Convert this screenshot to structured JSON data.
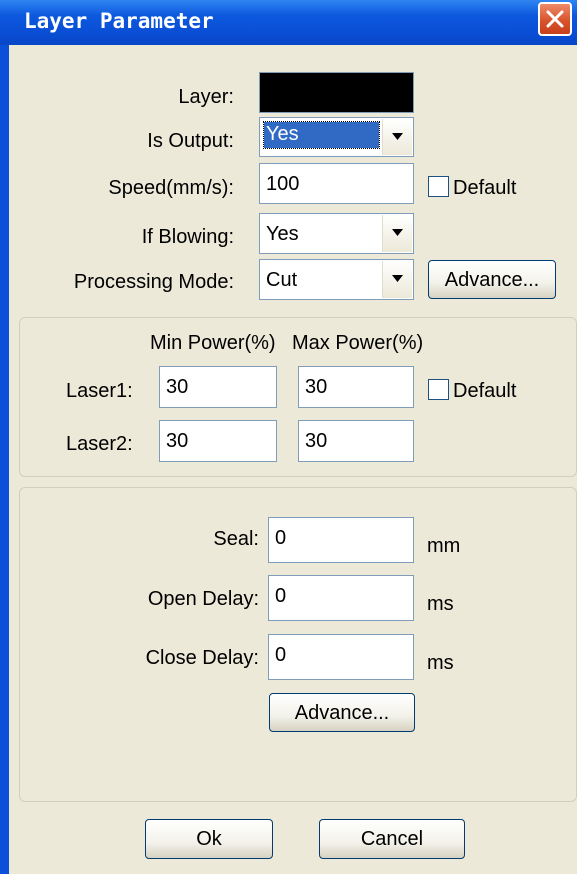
{
  "window": {
    "title": "Layer Parameter",
    "close_icon": "close-icon"
  },
  "colors": {
    "title_bar": "#0a50d8",
    "client_bg": "#ece9d8",
    "close_button": "#d8542d",
    "selection": "#316ac5",
    "layer_color": "#000000"
  },
  "general": {
    "layer_label": "Layer:",
    "is_output_label": "Is Output:",
    "is_output_value": "Yes",
    "speed_label": "Speed(mm/s):",
    "speed_value": "100",
    "speed_default_label": "Default",
    "blowing_label": "If Blowing:",
    "blowing_value": "Yes",
    "mode_label": "Processing Mode:",
    "mode_value": "Cut",
    "advance_label": "Advance..."
  },
  "power": {
    "min_header": "Min Power(%)",
    "max_header": "Max Power(%)",
    "laser1_label": "Laser1:",
    "laser1_min": "30",
    "laser1_max": "30",
    "default_label": "Default",
    "laser2_label": "Laser2:",
    "laser2_min": "30",
    "laser2_max": "30"
  },
  "timing": {
    "seal_label": "Seal:",
    "seal_value": "0",
    "seal_unit": "mm",
    "open_delay_label": "Open Delay:",
    "open_delay_value": "0",
    "open_delay_unit": "ms",
    "close_delay_label": "Close Delay:",
    "close_delay_value": "0",
    "close_delay_unit": "ms",
    "advance_label": "Advance..."
  },
  "footer": {
    "ok_label": "Ok",
    "cancel_label": "Cancel"
  }
}
